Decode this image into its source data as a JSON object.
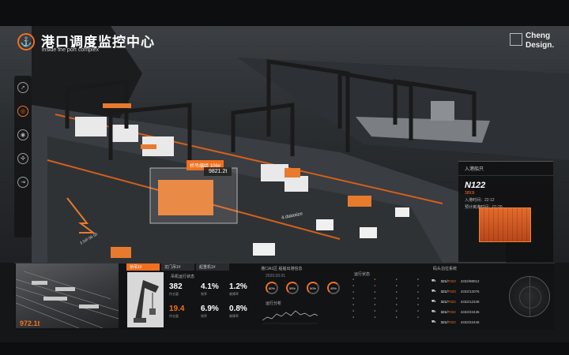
{
  "header": {
    "title": "港口调度监控中心",
    "subtitle": "inside the port complex",
    "brand_line1": "Cheng",
    "brand_line2": "Design."
  },
  "sidebar": {
    "items": [
      {
        "icon": "rocket-icon"
      },
      {
        "icon": "target-icon",
        "active": true
      },
      {
        "icon": "radar-icon"
      },
      {
        "icon": "network-icon"
      },
      {
        "icon": "exit-icon"
      }
    ]
  },
  "scene": {
    "crane_tag": "桥吊编组 106#",
    "crane_value": "9821.2t",
    "road_label": "4.datasize",
    "road_label2": "3.5t/f 08 00"
  },
  "ship_panel": {
    "heading": "入港船只",
    "ship_id": "N122",
    "ship_sub": "3893t",
    "arrive_time": "入港时间：22:12",
    "leave_time": "预计离港时间：01:20"
  },
  "dashboard": {
    "photo_value": "972.1t",
    "tabs": [
      "桥吊1#",
      "龙门吊1#",
      "起重机1#"
    ],
    "crane_caption": "吊机运行状态",
    "stats": [
      {
        "value": "382",
        "label": "作业量"
      },
      {
        "value": "4.1%",
        "label": "效率"
      },
      {
        "value": "1.2%",
        "label": "故障率"
      },
      {
        "value": "19.4",
        "label": "作业量",
        "orange": true
      },
      {
        "value": "6.9%",
        "label": "效率"
      },
      {
        "value": "0.8%",
        "label": "故障率"
      }
    ],
    "ops_title": "港口A1区 船舶出港信息",
    "ops_date": "2020.03.01",
    "gauges": [
      "80%",
      "55%",
      "50%",
      "45%"
    ],
    "line_title": "运行分析",
    "table_title": "运行状态",
    "truck_title": "码头泊位系统",
    "trucks": [
      {
        "plate": "321",
        "plate_hl": "F023",
        "code": "4332/98012"
      },
      {
        "plate": "321",
        "plate_hl": "F033",
        "code": "4332/12076"
      },
      {
        "plate": "321",
        "plate_hl": "F022",
        "code": "4332/12348"
      },
      {
        "plate": "321",
        "plate_hl": "F022",
        "code": "4332/22446"
      },
      {
        "plate": "321",
        "plate_hl": "F022",
        "code": "4332/22446"
      }
    ]
  },
  "colors": {
    "accent": "#f07020",
    "panel": "#141517",
    "success": "#3cc36a"
  }
}
